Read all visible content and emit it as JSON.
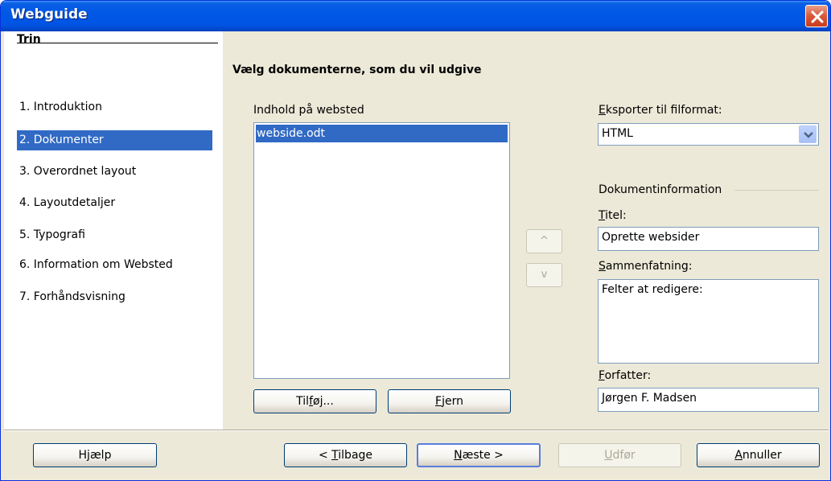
{
  "window": {
    "title": "Webguide"
  },
  "steps": {
    "header": "Trin",
    "items": [
      "1. Introduktion",
      "2. Dokumenter",
      "3. Overordnet layout",
      "4. Layoutdetaljer",
      "5. Typografi",
      "6. Information om Websted",
      "7. Forhåndsvisning"
    ],
    "selected_index": 1
  },
  "main": {
    "title": "Vælg dokumenterne, som du vil udgive",
    "content_label": "Indhold på websted",
    "documents": [
      "webside.odt"
    ],
    "add_button": {
      "pre": "Til",
      "key": "f",
      "post": "øj..."
    },
    "remove_button": {
      "pre": "",
      "key": "F",
      "post": "jern"
    },
    "move_up_glyph": "^",
    "move_down_glyph": "v",
    "export_label": {
      "pre": "",
      "key": "E",
      "post": "ksporter til filformat:"
    },
    "export_value": "HTML",
    "docinfo_label": "Dokumentinformation",
    "title_label": {
      "pre": "",
      "key": "T",
      "post": "itel:"
    },
    "title_value": "Oprette websider",
    "summary_label": {
      "pre": "",
      "key": "S",
      "post": "ammenfatning:"
    },
    "summary_value": "Felter at redigere:",
    "author_label": {
      "pre": "",
      "key": "F",
      "post": "orfatter:"
    },
    "author_value": "Jørgen F. Madsen"
  },
  "footer": {
    "help": {
      "pre": "H",
      "key": "j",
      "post": "ælp"
    },
    "back": {
      "pre": "< ",
      "key": "T",
      "post": "ilbage"
    },
    "next": {
      "pre": "",
      "key": "N",
      "post": "æste >"
    },
    "finish": {
      "pre": "",
      "key": "U",
      "post": "dfør"
    },
    "cancel": {
      "pre": "",
      "key": "A",
      "post": "nnuller"
    }
  },
  "colors": {
    "selection": "#316ac5",
    "titlebar": "#0054e3",
    "dialog_bg": "#ece9d8"
  }
}
